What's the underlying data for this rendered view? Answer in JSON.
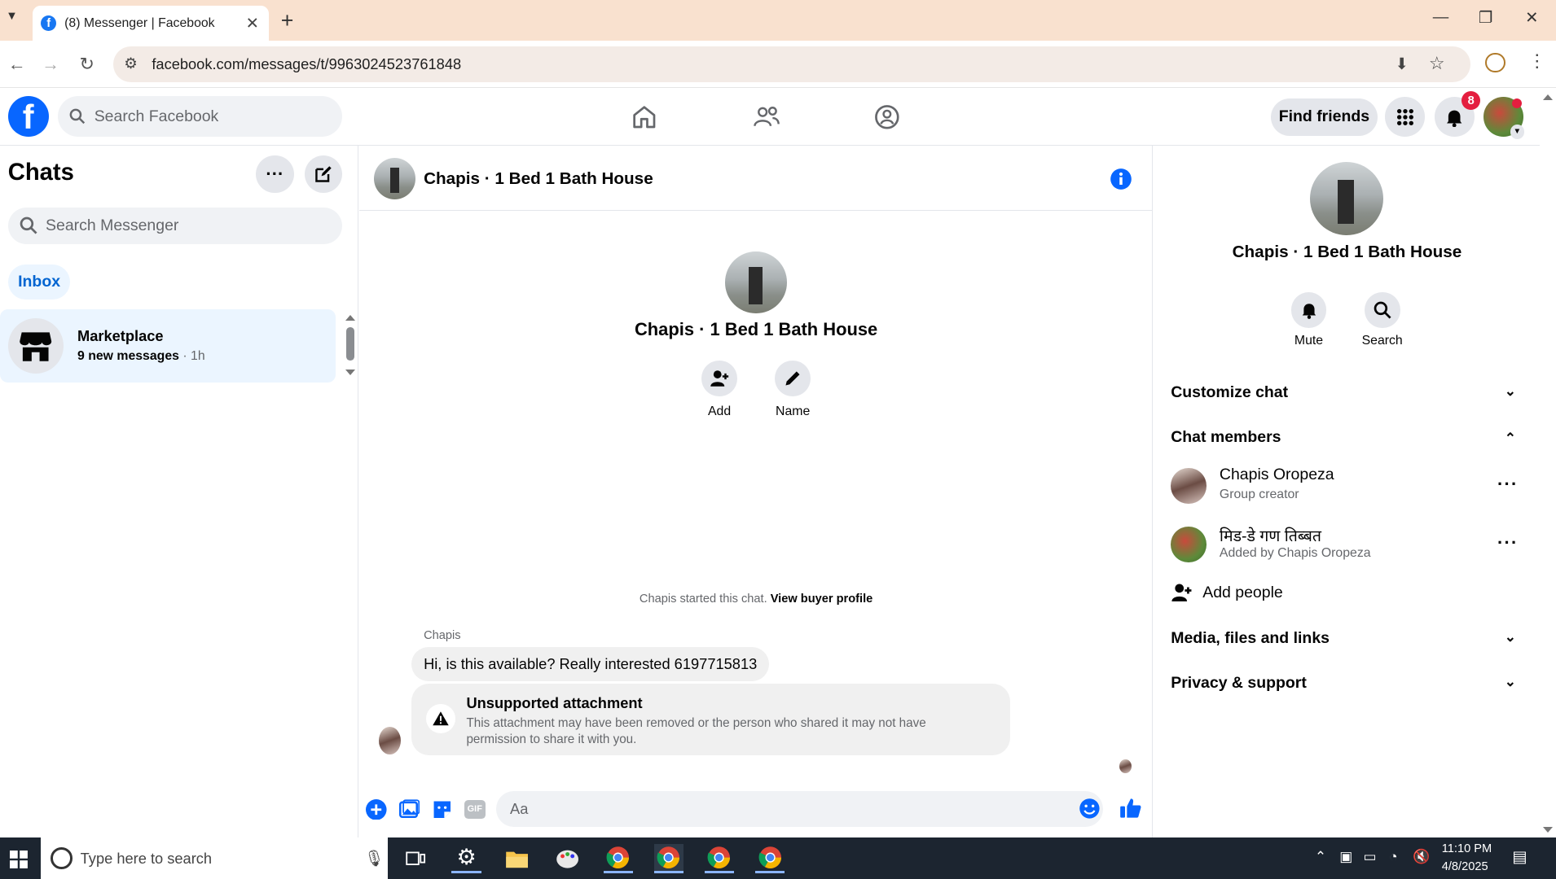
{
  "browser": {
    "tab_title": "(8) Messenger | Facebook",
    "url": "facebook.com/messages/t/9963024523761848"
  },
  "fb": {
    "search_placeholder": "Search Facebook",
    "find_friends": "Find friends",
    "notif_count": "8"
  },
  "left": {
    "title": "Chats",
    "search_placeholder": "Search Messenger",
    "filter": "Inbox",
    "chat_item": {
      "title": "Marketplace",
      "subtitle": "9 new messages",
      "time": " · 1h"
    }
  },
  "center": {
    "header_title": "Chapis · 1 Bed 1 Bath House",
    "big_name": "Chapis · 1 Bed 1 Bath House",
    "action_add": "Add",
    "action_name": "Name",
    "started_text": "Chapis started this chat. ",
    "view_profile": "View buyer profile",
    "sender": "Chapis",
    "message": "Hi, is this available? Really interested 6197715813",
    "attach_title": "Unsupported attachment",
    "attach_desc": "This attachment may have been removed or the person who shared it may not have permission to share it with you.",
    "composer_placeholder": "Aa"
  },
  "right": {
    "name": "Chapis · 1 Bed 1 Bath House",
    "mute": "Mute",
    "search": "Search",
    "customize": "Customize chat",
    "members_title": "Chat members",
    "members": [
      {
        "name": "Chapis Oropeza",
        "role": "Group creator"
      },
      {
        "name": "मिड-डे गण तिब्बत",
        "role": "Added by Chapis Oropeza"
      }
    ],
    "add_people": "Add people",
    "media": "Media, files and links",
    "privacy": "Privacy & support"
  },
  "taskbar": {
    "search_placeholder": "Type here to search",
    "time": "11:10 PM",
    "date": "4/8/2025"
  },
  "colors": {
    "brand": "#0866ff",
    "accent": "#0064d1",
    "tab_bg": "#f9e1cf"
  }
}
